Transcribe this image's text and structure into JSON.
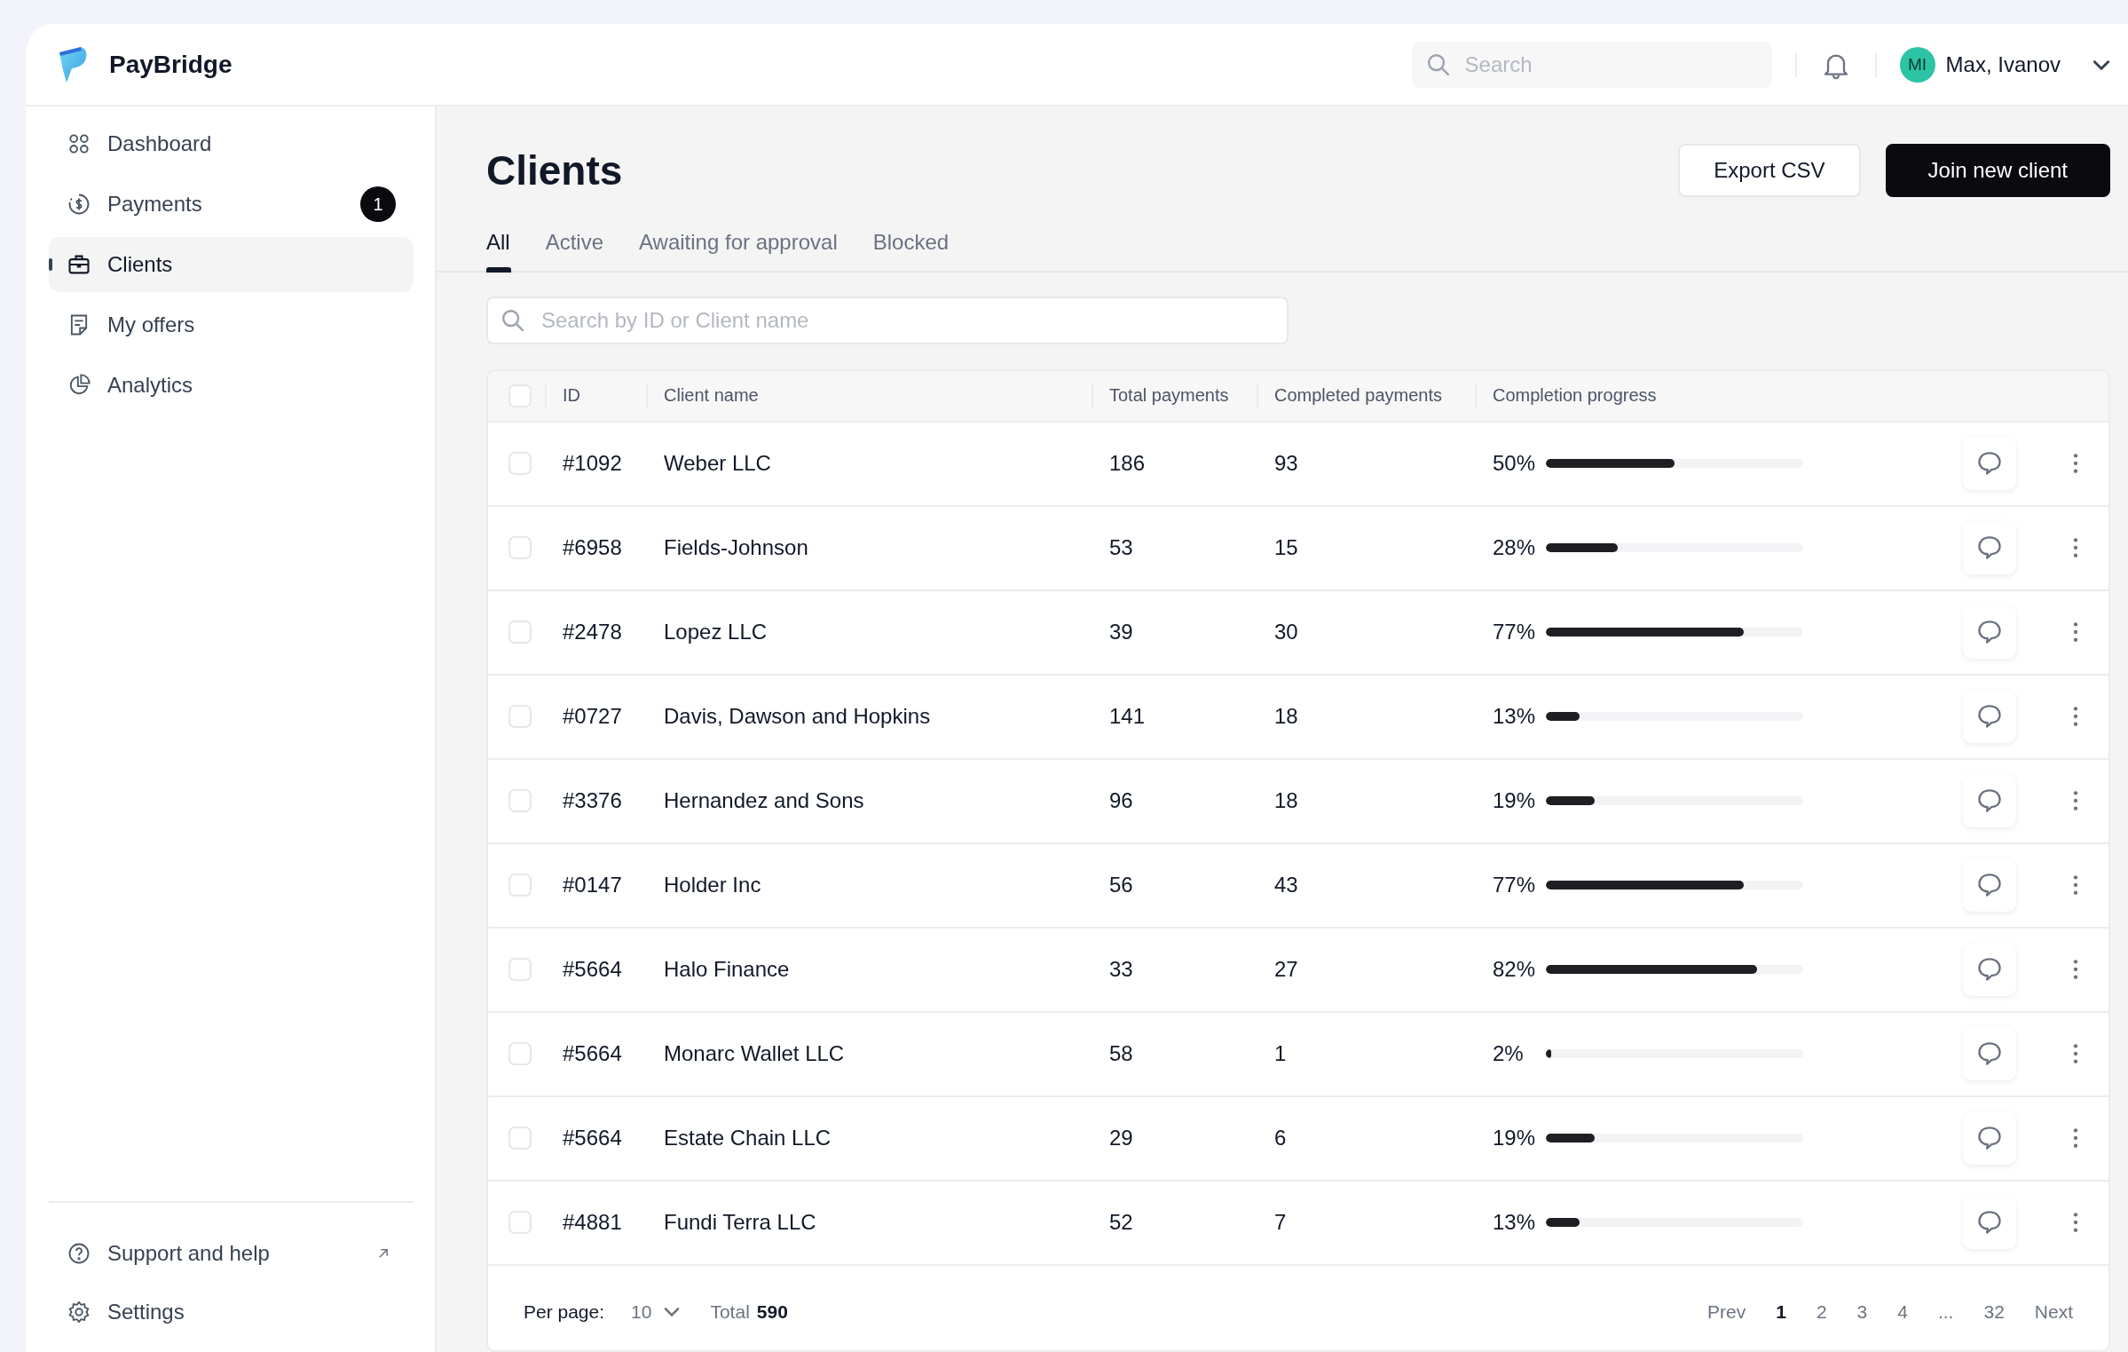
{
  "app": {
    "name": "PayBridge"
  },
  "header": {
    "search_placeholder": "Search",
    "user": {
      "initials": "MI",
      "name": "Max, Ivanov"
    }
  },
  "sidebar": {
    "items": [
      {
        "label": "Dashboard",
        "kind": "dashboard",
        "selected": false
      },
      {
        "label": "Payments",
        "kind": "payments",
        "selected": false,
        "badge": "1"
      },
      {
        "label": "Clients",
        "kind": "clients",
        "selected": true
      },
      {
        "label": "My offers",
        "kind": "offers",
        "selected": false
      },
      {
        "label": "Analytics",
        "kind": "analytics",
        "selected": false
      }
    ],
    "footer_items": [
      {
        "label": "Support and help",
        "kind": "help",
        "external": true
      },
      {
        "label": "Settings",
        "kind": "settings",
        "external": false
      }
    ]
  },
  "page": {
    "title": "Clients",
    "buttons": [
      {
        "label": "Export CSV",
        "kind": "secondary"
      },
      {
        "label": "Join new client",
        "kind": "primary"
      }
    ],
    "tabs": [
      {
        "label": "All",
        "selected": true
      },
      {
        "label": "Active",
        "selected": false
      },
      {
        "label": "Awaiting for approval",
        "selected": false
      },
      {
        "label": "Blocked",
        "selected": false
      }
    ],
    "search_placeholder": "Search by ID or Client name"
  },
  "table": {
    "select_all_checked": false,
    "columns": [
      "ID",
      "Client name",
      "Total payments",
      "Completed payments",
      "Completion progress"
    ],
    "rows": [
      {
        "checked": false,
        "id": "#1092",
        "name": "Weber LLC",
        "total": "186",
        "completed": "93",
        "progress": "50%",
        "level": 0.5
      },
      {
        "checked": false,
        "id": "#6958",
        "name": "Fields-Johnson",
        "total": "53",
        "completed": "15",
        "progress": "28%",
        "level": 0.28
      },
      {
        "checked": false,
        "id": "#2478",
        "name": "Lopez LLC",
        "total": "39",
        "completed": "30",
        "progress": "77%",
        "level": 0.77
      },
      {
        "checked": false,
        "id": "#0727",
        "name": "Davis, Dawson and Hopkins",
        "total": "141",
        "completed": "18",
        "progress": "13%",
        "level": 0.13
      },
      {
        "checked": false,
        "id": "#3376",
        "name": "Hernandez and Sons",
        "total": "96",
        "completed": "18",
        "progress": "19%",
        "level": 0.19
      },
      {
        "checked": false,
        "id": "#0147",
        "name": "Holder Inc",
        "total": "56",
        "completed": "43",
        "progress": "77%",
        "level": 0.77
      },
      {
        "checked": false,
        "id": "#5664",
        "name": "Halo Finance",
        "total": "33",
        "completed": "27",
        "progress": "82%",
        "level": 0.82
      },
      {
        "checked": false,
        "id": "#5664",
        "name": "Monarc Wallet LLC",
        "total": "58",
        "completed": "1",
        "progress": "2%",
        "level": 0.02
      },
      {
        "checked": false,
        "id": "#5664",
        "name": "Estate Chain LLC",
        "total": "29",
        "completed": "6",
        "progress": "19%",
        "level": 0.19
      },
      {
        "checked": false,
        "id": "#4881",
        "name": "Fundi Terra LLC",
        "total": "52",
        "completed": "7",
        "progress": "13%",
        "level": 0.13
      }
    ]
  },
  "pagination": {
    "per_page_label": "Per page:",
    "per_page": "10",
    "total_label": "Total",
    "total": "590",
    "prev": "Prev",
    "next": "Next",
    "pages": [
      {
        "label": "1",
        "selected": true
      },
      {
        "label": "2",
        "selected": false
      },
      {
        "label": "3",
        "selected": false
      },
      {
        "label": "4",
        "selected": false
      },
      {
        "label": "...",
        "selected": false
      },
      {
        "label": "32",
        "selected": false
      }
    ]
  }
}
